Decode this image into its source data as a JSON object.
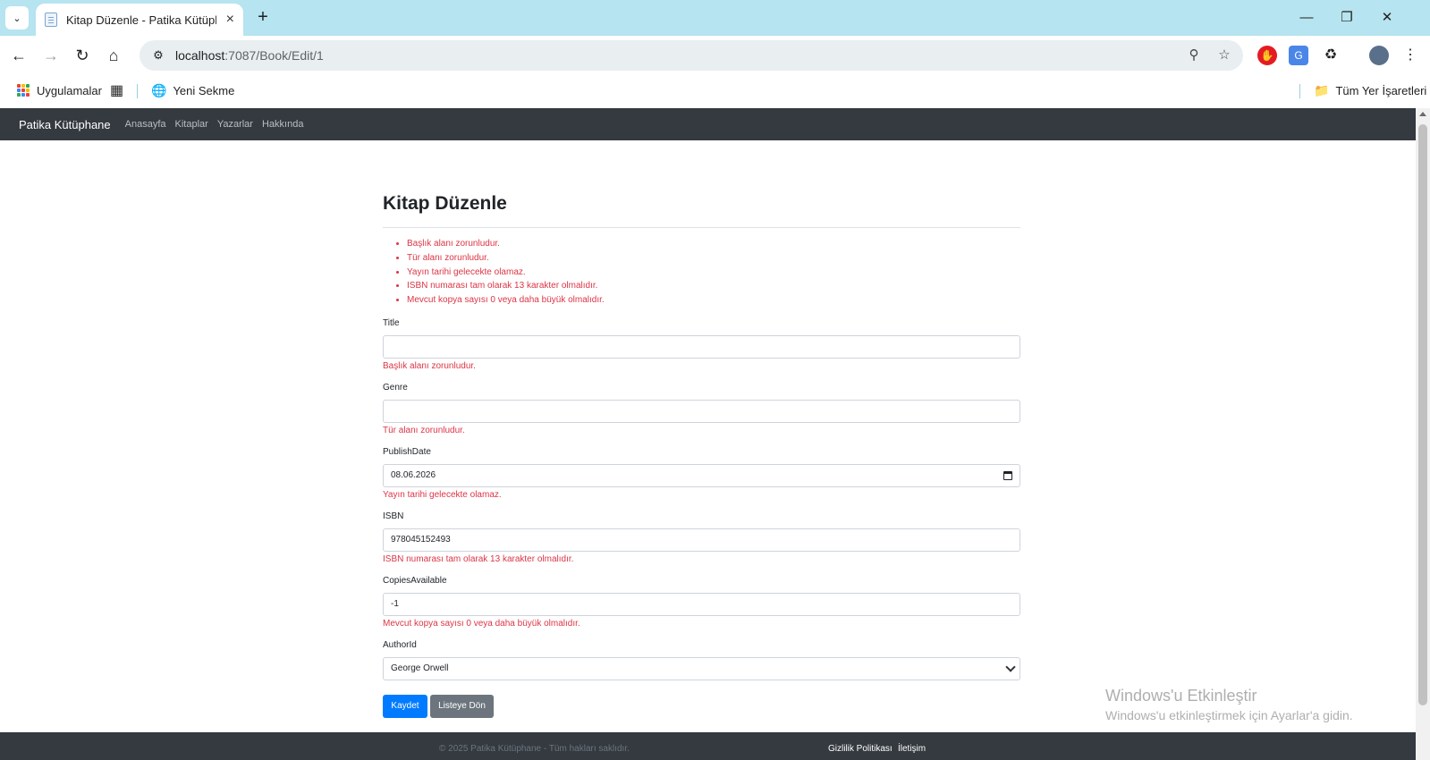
{
  "browser": {
    "tab_title": "Kitap Düzenle - Patika Kütüphane",
    "url_host": "localhost",
    "url_path": ":7087/Book/Edit/1",
    "bookmarks": {
      "apps_label": "Uygulamalar",
      "new_tab_label": "Yeni Sekme",
      "all_bookmarks_label": "Tüm Yer İşaretleri"
    }
  },
  "navbar": {
    "brand": "Patika Kütüphane",
    "links": [
      "Anasayfa",
      "Kitaplar",
      "Yazarlar",
      "Hakkında"
    ]
  },
  "form": {
    "heading": "Kitap Düzenle",
    "summary_errors": [
      "Başlık alanı zorunludur.",
      "Tür alanı zorunludur.",
      "Yayın tarihi gelecekte olamaz.",
      "ISBN numarası tam olarak 13 karakter olmalıdır.",
      "Mevcut kopya sayısı 0 veya daha büyük olmalıdır."
    ],
    "fields": {
      "title": {
        "label": "Title",
        "value": "",
        "error": "Başlık alanı zorunludur."
      },
      "genre": {
        "label": "Genre",
        "value": "",
        "error": "Tür alanı zorunludur."
      },
      "publish_date": {
        "label": "PublishDate",
        "value": "08.06.2026",
        "error": "Yayın tarihi gelecekte olamaz."
      },
      "isbn": {
        "label": "ISBN",
        "value": "978045152493",
        "error": "ISBN numarası tam olarak 13 karakter olmalıdır."
      },
      "copies": {
        "label": "CopiesAvailable",
        "value": "-1",
        "error": "Mevcut kopya sayısı 0 veya daha büyük olmalıdır."
      },
      "author": {
        "label": "AuthorId",
        "selected": "George Orwell"
      }
    },
    "save_label": "Kaydet",
    "back_label": "Listeye Dön"
  },
  "footer": {
    "copyright": "© 2025 Patika Kütüphane - Tüm hakları saklıdır.",
    "privacy": "Gizlilik Politikası",
    "contact": "İletişim"
  },
  "watermark": {
    "title": "Windows'u Etkinleştir",
    "subtitle": "Windows'u etkinleştirmek için Ayarlar'a gidin."
  },
  "colors": {
    "navbar_bg": "#343a40",
    "error": "#dc3545",
    "primary": "#007bff",
    "secondary": "#6c757d",
    "tabbar_bg": "#b6e4f0"
  }
}
